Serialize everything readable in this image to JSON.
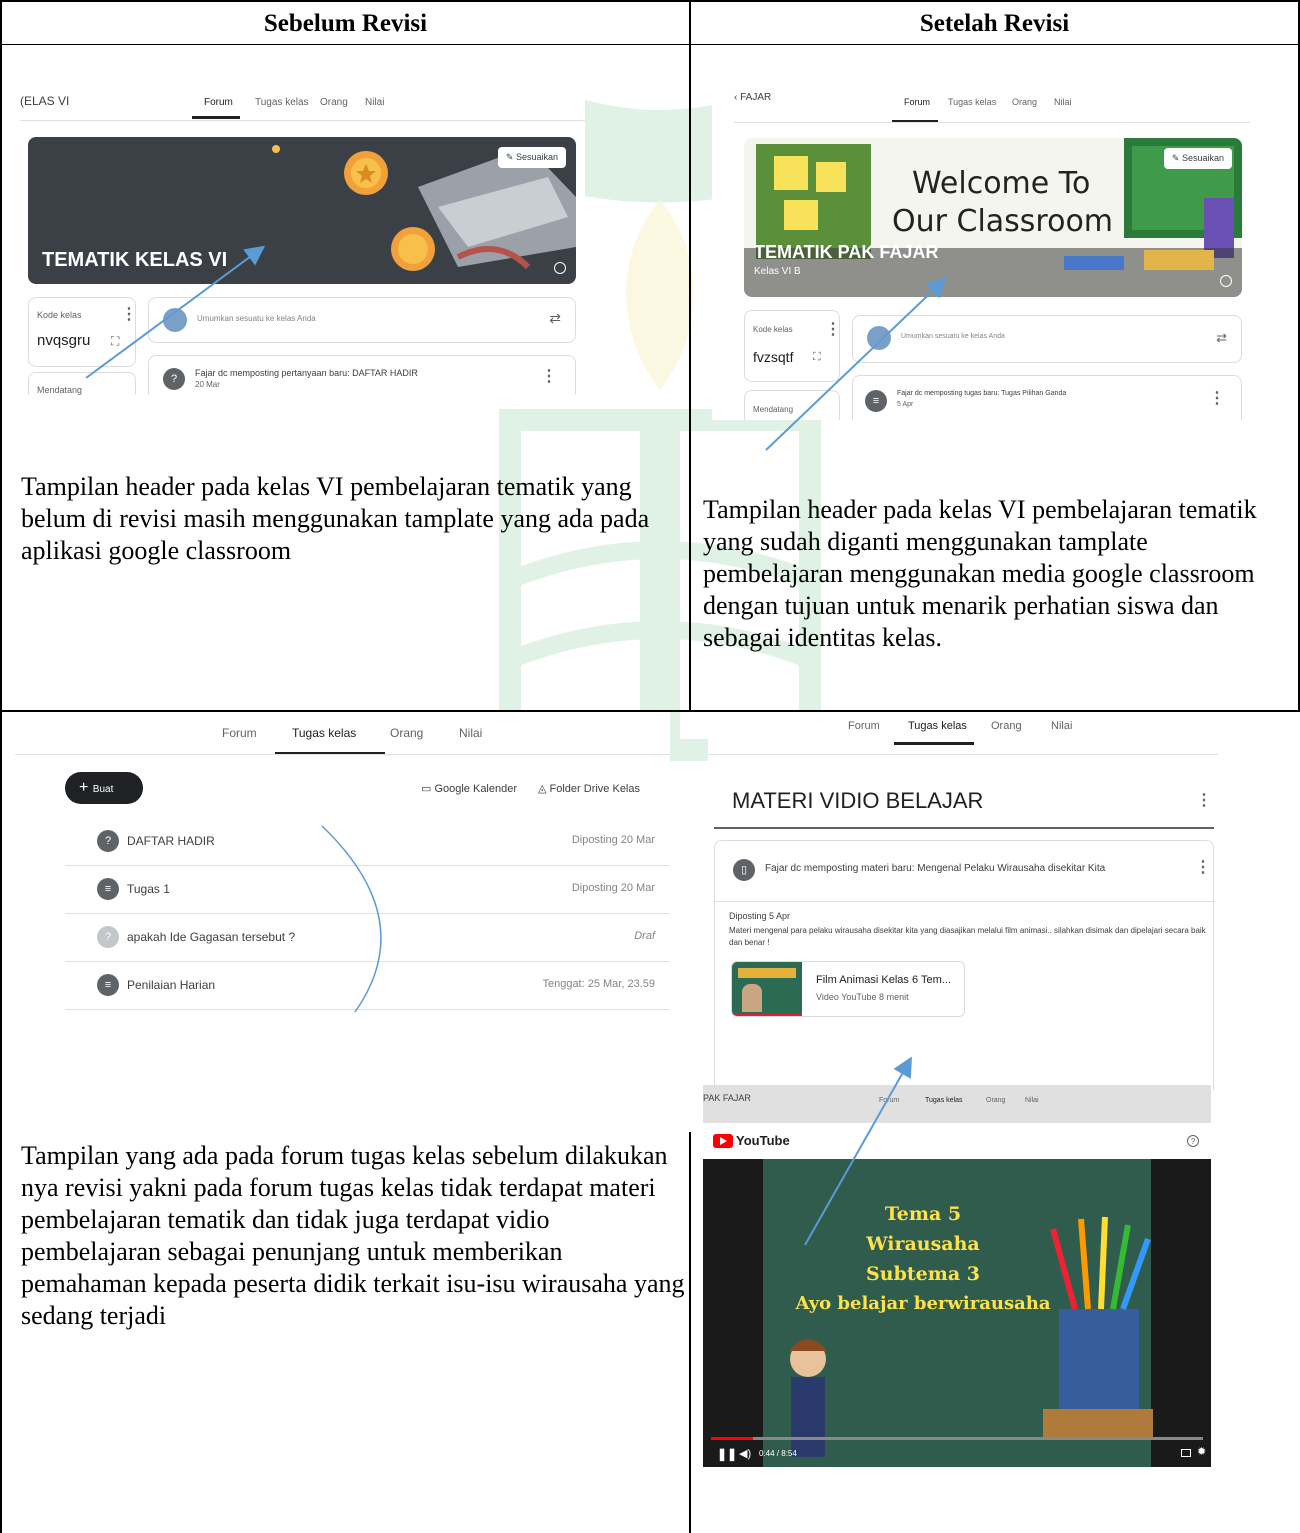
{
  "headers": {
    "before": "Sebelum Revisi",
    "after": "Setelah Revisi"
  },
  "captions": {
    "top_left": "Tampilan header pada kelas VI pembelajaran tematik yang belum di revisi masih menggunakan tamplate yang ada pada aplikasi google classroom",
    "top_right": "Tampilan header pada kelas VI pembelajaran tematik yang sudah diganti menggunakan tamplate pembelajaran menggunakan media google classroom dengan tujuan untuk menarik perhatian siswa dan sebagai identitas kelas.",
    "bottom_left": "Tampilan yang ada pada forum tugas kelas sebelum dilakukan nya revisi yakni pada forum tugas kelas tidak terdapat materi pembelajaran tematik dan tidak juga terdapat vidio pembelajaran sebagai penunjang untuk memberikan pemahaman kepada peserta didik terkait isu-isu wirausaha yang sedang terjadi"
  },
  "tabs": {
    "forum": "Forum",
    "tugas": "Tugas kelas",
    "orang": "Orang",
    "nilai": "Nilai"
  },
  "s1": {
    "class_short": "(ELAS VI",
    "customize": "Sesuaikan",
    "banner_title": "TEMATIK KELAS VI",
    "code_label": "Kode kelas",
    "code": "nvqsgru",
    "upcoming": "Mendatang",
    "announce": "Umumkan sesuatu ke kelas Anda",
    "post_title": "Fajar dc memposting pertanyaan baru: DAFTAR HADIR",
    "post_date": "20 Mar"
  },
  "s2": {
    "class_short": "‹ FAJAR",
    "customize": "Sesuaikan",
    "welcome1": "Welcome To",
    "welcome2": "Our Classroom",
    "banner_title": "TEMATIK PAK FAJAR",
    "banner_sub": "Kelas VI B",
    "code_label": "Kode kelas",
    "code": "fvzsqtf",
    "upcoming": "Mendatang",
    "announce": "Umumkan sesuatu ke kelas Anda",
    "post_title": "Fajar dc memposting tugas baru: Tugas Pilihan Ganda",
    "post_date": "5 Apr"
  },
  "s3": {
    "create": "Buat",
    "calendar": "Google Kalender",
    "drive": "Folder Drive Kelas",
    "rows": [
      {
        "title": "DAFTAR HADIR",
        "date": "Diposting 20 Mar",
        "icon": "?"
      },
      {
        "title": "Tugas 1",
        "date": "Diposting 20 Mar",
        "icon": "≡"
      },
      {
        "title": "apakah Ide Gagasan tersebut ?",
        "date": "Draf",
        "icon": "?"
      },
      {
        "title": "Penilaian Harian",
        "date": "Tenggat: 25 Mar, 23.59",
        "icon": "≡"
      }
    ]
  },
  "s4": {
    "topic": "MATERI VIDIO BELAJAR",
    "post_title": "Fajar dc memposting materi baru: Mengenal Pelaku Wirausaha disekitar Kita",
    "posted": "Diposting 5 Apr",
    "desc": "Materi mengenal para pelaku wirausaha disekitar kita yang diasajikan melalui film animasi.. silahkan disimak dan dipelajari secara baik dan benar !",
    "attach_title": "Film Animasi Kelas 6 Tem...",
    "attach_meta": "Video YouTube  8 menit"
  },
  "s5": {
    "class_short": "PAK FAJAR",
    "youtube": "YouTube",
    "l1": "Tema 5",
    "l2": "Wirausaha",
    "l3": "Subtema 3",
    "l4": "Ayo belajar berwirausaha",
    "time": "0:44 / 8:54"
  },
  "colors": {
    "arrow": "#5b9bd5",
    "banner_dark": "#3b4046",
    "board_green": "#2f5c4d",
    "yt_red": "#ff0000",
    "watermark": "#46b16a"
  }
}
